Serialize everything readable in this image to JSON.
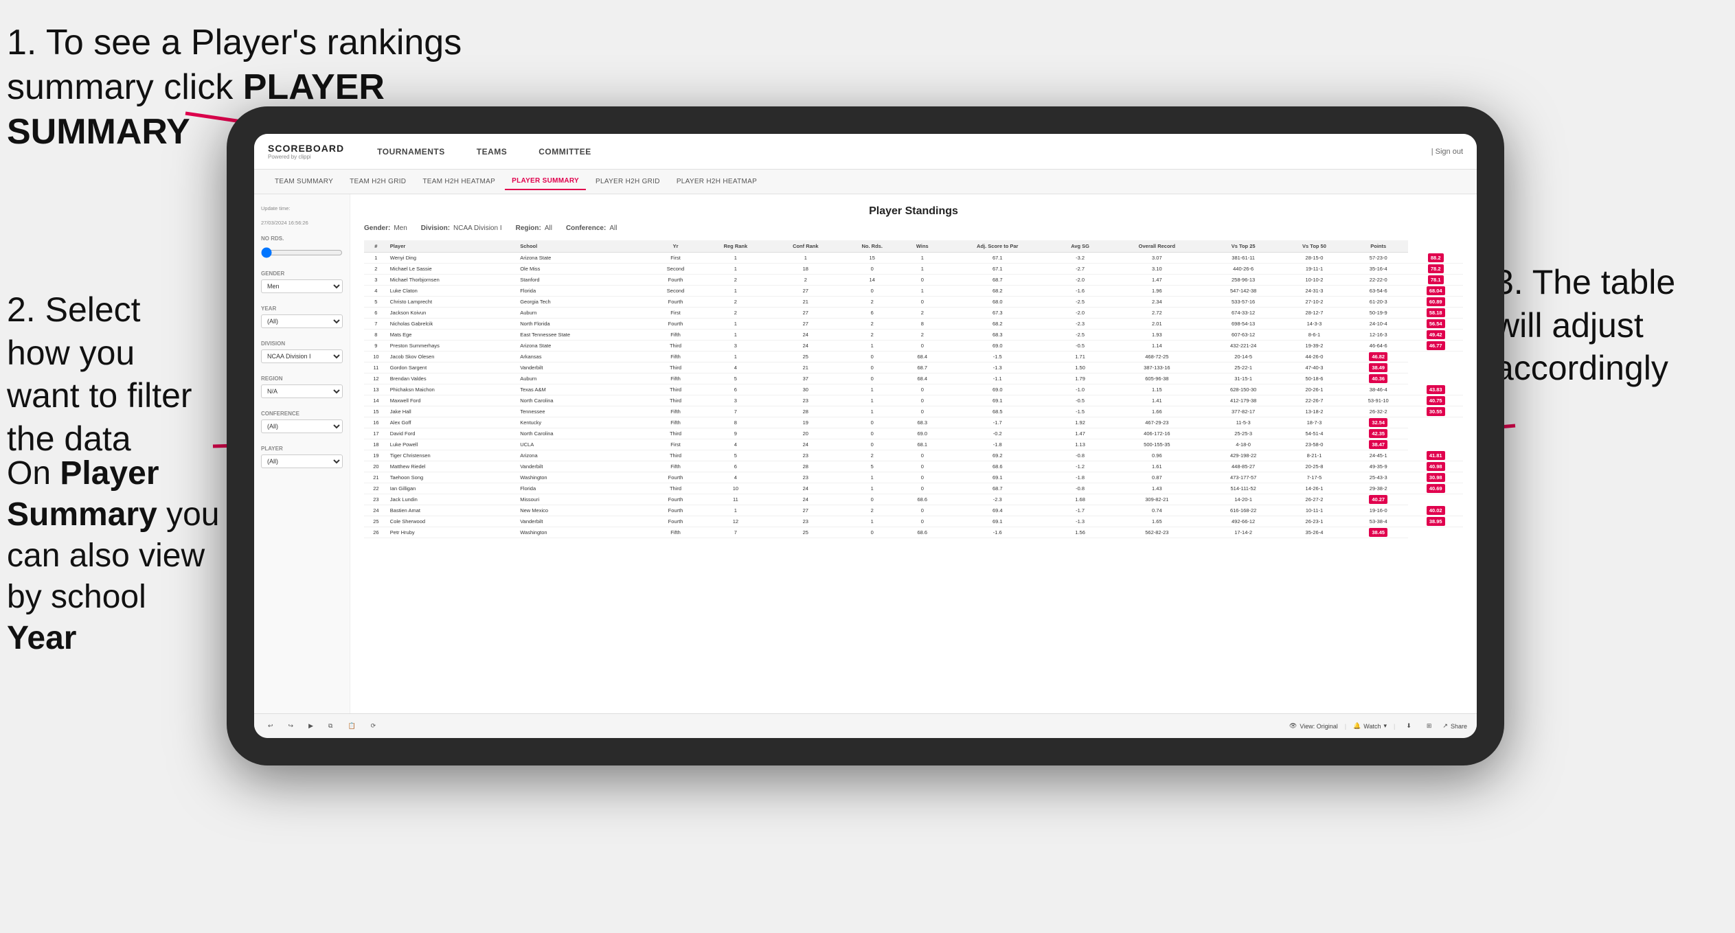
{
  "annotations": {
    "step1": "1. To see a Player's rankings summary click ",
    "step1_bold": "PLAYER SUMMARY",
    "step2_title": "2. Select how you want to filter the data",
    "step3_title": "3. The table will adjust accordingly",
    "step4_title": "On ",
    "step4_bold1": "Player Summary",
    "step4_mid": " you can also view by school ",
    "step4_bold2": "Year"
  },
  "nav": {
    "logo_title": "SCOREBOARD",
    "logo_subtitle": "Powered by clippi",
    "items": [
      "TOURNAMENTS",
      "TEAMS",
      "COMMITTEE"
    ],
    "sign_in": "| Sign out"
  },
  "sub_nav": {
    "items": [
      "TEAM SUMMARY",
      "TEAM H2H GRID",
      "TEAM H2H HEATMAP",
      "PLAYER SUMMARY",
      "PLAYER H2H GRID",
      "PLAYER H2H HEATMAP"
    ],
    "active": "PLAYER SUMMARY"
  },
  "sidebar": {
    "update_label": "Update time:",
    "update_time": "27/03/2024 16:56:26",
    "no_rds_label": "No Rds.",
    "gender_label": "Gender",
    "gender_value": "Men",
    "year_label": "Year",
    "year_value": "(All)",
    "division_label": "Division",
    "division_value": "NCAA Division I",
    "region_label": "Region",
    "region_value": "N/A",
    "conference_label": "Conference",
    "conference_value": "(All)",
    "player_label": "Player",
    "player_value": "(All)"
  },
  "table": {
    "title": "Player Standings",
    "filters": {
      "gender_label": "Gender:",
      "gender_val": "Men",
      "division_label": "Division:",
      "division_val": "NCAA Division I",
      "region_label": "Region:",
      "region_val": "All",
      "conference_label": "Conference:",
      "conference_val": "All"
    },
    "headers": [
      "#",
      "Player",
      "School",
      "Yr",
      "Reg Rank",
      "Conf Rank",
      "No. Rds.",
      "Wins",
      "Adj. Score to Par",
      "Avg SG",
      "Overall Record",
      "Vs Top 25",
      "Vs Top 50",
      "Points"
    ],
    "rows": [
      [
        "1",
        "Wenyi Ding",
        "Arizona State",
        "First",
        "1",
        "1",
        "15",
        "1",
        "67.1",
        "-3.2",
        "3.07",
        "381-61-11",
        "28-15-0",
        "57-23-0",
        "88.2"
      ],
      [
        "2",
        "Michael Le Sassie",
        "Ole Miss",
        "Second",
        "1",
        "18",
        "0",
        "1",
        "67.1",
        "-2.7",
        "3.10",
        "440-26-6",
        "19-11-1",
        "35-16-4",
        "78.2"
      ],
      [
        "3",
        "Michael Thorbjornsen",
        "Stanford",
        "Fourth",
        "2",
        "2",
        "14",
        "0",
        "68.7",
        "-2.0",
        "1.47",
        "258-96-13",
        "10-10-2",
        "22-22-0",
        "78.1"
      ],
      [
        "4",
        "Luke Claton",
        "Florida",
        "Second",
        "1",
        "27",
        "0",
        "1",
        "68.2",
        "-1.6",
        "1.96",
        "547-142-38",
        "24-31-3",
        "63-54-6",
        "68.04"
      ],
      [
        "5",
        "Christo Lamprecht",
        "Georgia Tech",
        "Fourth",
        "2",
        "21",
        "2",
        "0",
        "68.0",
        "-2.5",
        "2.34",
        "533-57-16",
        "27-10-2",
        "61-20-3",
        "60.89"
      ],
      [
        "6",
        "Jackson Koivun",
        "Auburn",
        "First",
        "2",
        "27",
        "6",
        "2",
        "67.3",
        "-2.0",
        "2.72",
        "674-33-12",
        "28-12-7",
        "50-19-9",
        "58.18"
      ],
      [
        "7",
        "Nicholas Gabrelcik",
        "North Florida",
        "Fourth",
        "1",
        "27",
        "2",
        "8",
        "68.2",
        "-2.3",
        "2.01",
        "698-54-13",
        "14-3-3",
        "24-10-4",
        "56.54"
      ],
      [
        "8",
        "Mats Ege",
        "East Tennessee State",
        "Fifth",
        "1",
        "24",
        "2",
        "2",
        "68.3",
        "-2.5",
        "1.93",
        "607-63-12",
        "8-6-1",
        "12-16-3",
        "49.42"
      ],
      [
        "9",
        "Preston Summerhays",
        "Arizona State",
        "Third",
        "3",
        "24",
        "1",
        "0",
        "69.0",
        "-0.5",
        "1.14",
        "432-221-24",
        "19-39-2",
        "46-64-6",
        "46.77"
      ],
      [
        "10",
        "Jacob Skov Olesen",
        "Arkansas",
        "Fifth",
        "1",
        "25",
        "0",
        "68.4",
        "-1.5",
        "1.71",
        "468-72-25",
        "20-14-5",
        "44-26-0",
        "46.82"
      ],
      [
        "11",
        "Gordon Sargent",
        "Vanderbilt",
        "Third",
        "4",
        "21",
        "0",
        "68.7",
        "-1.3",
        "1.50",
        "387-133-16",
        "25-22-1",
        "47-40-3",
        "38.49"
      ],
      [
        "12",
        "Brendan Valdes",
        "Auburn",
        "Fifth",
        "5",
        "37",
        "0",
        "68.4",
        "-1.1",
        "1.79",
        "605-96-38",
        "31-15-1",
        "50-18-6",
        "40.36"
      ],
      [
        "13",
        "Phichaksn Maichon",
        "Texas A&M",
        "Third",
        "6",
        "30",
        "1",
        "0",
        "69.0",
        "-1.0",
        "1.15",
        "628-150-30",
        "20-26-1",
        "38-46-4",
        "43.83"
      ],
      [
        "14",
        "Maxwell Ford",
        "North Carolina",
        "Third",
        "3",
        "23",
        "1",
        "0",
        "69.1",
        "-0.5",
        "1.41",
        "412-179-38",
        "22-26-7",
        "53-91-10",
        "40.75"
      ],
      [
        "15",
        "Jake Hall",
        "Tennessee",
        "Fifth",
        "7",
        "28",
        "1",
        "0",
        "68.5",
        "-1.5",
        "1.66",
        "377-82-17",
        "13-18-2",
        "26-32-2",
        "30.55"
      ],
      [
        "16",
        "Alex Goff",
        "Kentucky",
        "Fifth",
        "8",
        "19",
        "0",
        "68.3",
        "-1.7",
        "1.92",
        "467-29-23",
        "11-5-3",
        "18-7-3",
        "32.54"
      ],
      [
        "17",
        "David Ford",
        "North Carolina",
        "Third",
        "9",
        "20",
        "0",
        "69.0",
        "-0.2",
        "1.47",
        "406-172-16",
        "25-25-3",
        "54-51-4",
        "42.35"
      ],
      [
        "18",
        "Luke Powell",
        "UCLA",
        "First",
        "4",
        "24",
        "0",
        "68.1",
        "-1.8",
        "1.13",
        "500-155-35",
        "4-18-0",
        "23-58-0",
        "38.47"
      ],
      [
        "19",
        "Tiger Christensen",
        "Arizona",
        "Third",
        "5",
        "23",
        "2",
        "0",
        "69.2",
        "-0.8",
        "0.96",
        "429-198-22",
        "8-21-1",
        "24-45-1",
        "41.81"
      ],
      [
        "20",
        "Matthew Riedel",
        "Vanderbilt",
        "Fifth",
        "6",
        "28",
        "5",
        "0",
        "68.6",
        "-1.2",
        "1.61",
        "448-85-27",
        "20-25-8",
        "49-35-9",
        "40.98"
      ],
      [
        "21",
        "Taehoon Song",
        "Washington",
        "Fourth",
        "4",
        "23",
        "1",
        "0",
        "69.1",
        "-1.8",
        "0.87",
        "473-177-57",
        "7-17-5",
        "25-43-3",
        "30.98"
      ],
      [
        "22",
        "Ian Gilligan",
        "Florida",
        "Third",
        "10",
        "24",
        "1",
        "0",
        "68.7",
        "-0.8",
        "1.43",
        "514-111-52",
        "14-26-1",
        "29-38-2",
        "40.69"
      ],
      [
        "23",
        "Jack Lundin",
        "Missouri",
        "Fourth",
        "11",
        "24",
        "0",
        "68.6",
        "-2.3",
        "1.68",
        "309-82-21",
        "14-20-1",
        "26-27-2",
        "40.27"
      ],
      [
        "24",
        "Bastien Amat",
        "New Mexico",
        "Fourth",
        "1",
        "27",
        "2",
        "0",
        "69.4",
        "-1.7",
        "0.74",
        "616-168-22",
        "10-11-1",
        "19-16-0",
        "40.02"
      ],
      [
        "25",
        "Cole Sherwood",
        "Vanderbilt",
        "Fourth",
        "12",
        "23",
        "1",
        "0",
        "69.1",
        "-1.3",
        "1.65",
        "492-66-12",
        "26-23-1",
        "53-38-4",
        "38.95"
      ],
      [
        "26",
        "Petr Hruby",
        "Washington",
        "Fifth",
        "7",
        "25",
        "0",
        "68.6",
        "-1.6",
        "1.56",
        "562-82-23",
        "17-14-2",
        "35-26-4",
        "38.45"
      ]
    ]
  },
  "toolbar": {
    "view_label": "View: Original",
    "watch_label": "Watch",
    "share_label": "Share"
  }
}
